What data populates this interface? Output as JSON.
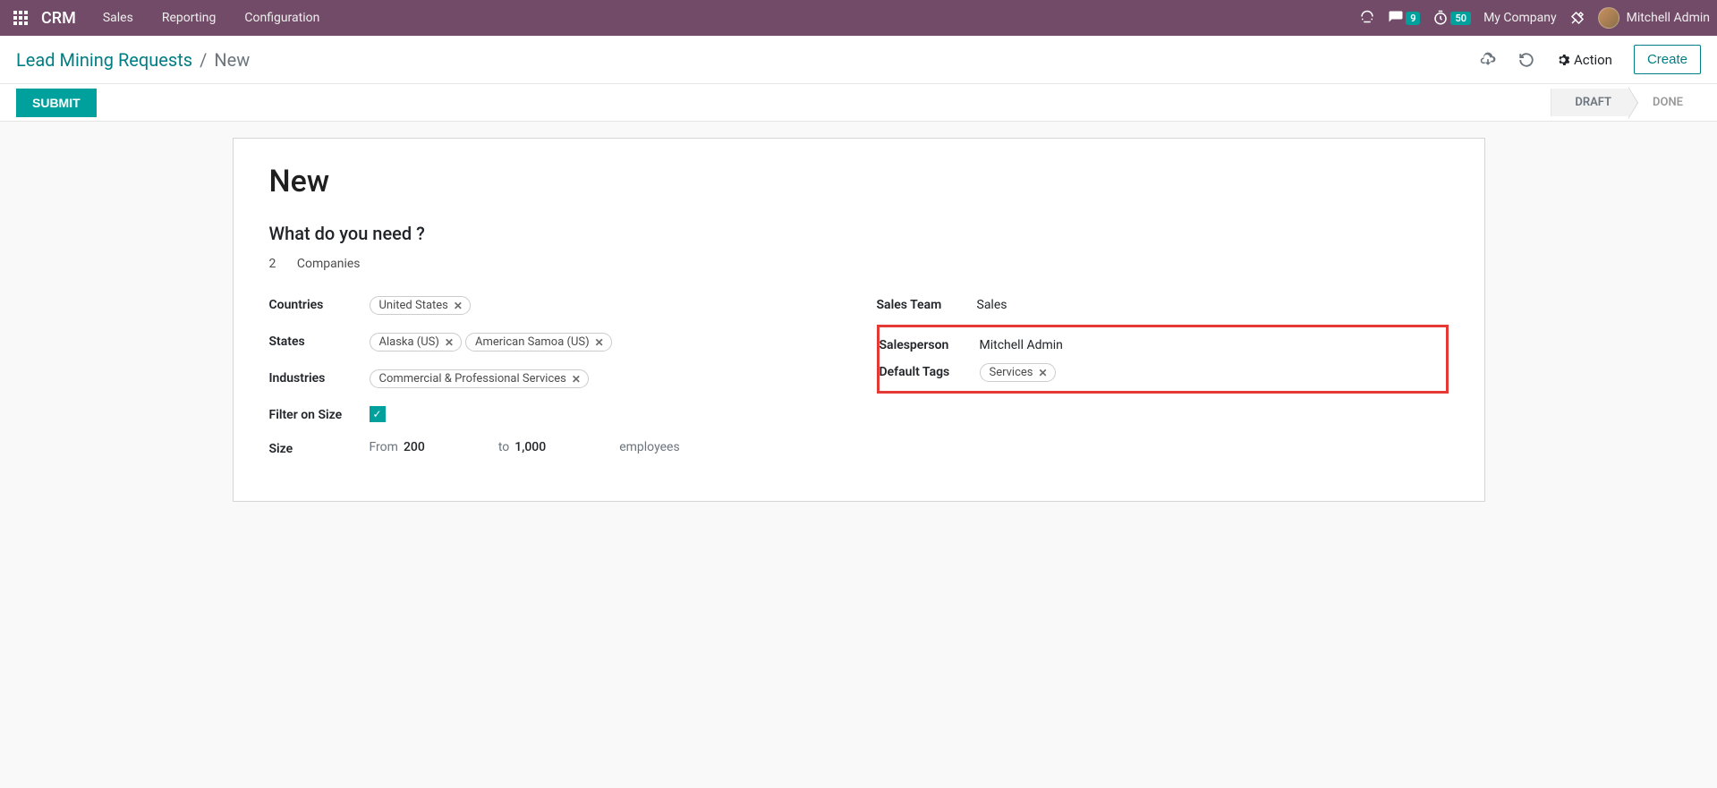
{
  "navbar": {
    "brand": "CRM",
    "menu": [
      "Sales",
      "Reporting",
      "Configuration"
    ],
    "discuss_badge": "9",
    "timer_badge": "50",
    "company": "My Company",
    "user": "Mitchell Admin"
  },
  "control": {
    "breadcrumb_link": "Lead Mining Requests",
    "breadcrumb_current": "New",
    "action_label": "Action",
    "create_label": "Create"
  },
  "status": {
    "submit_label": "SUBMIT",
    "steps": [
      "DRAFT",
      "DONE"
    ]
  },
  "form": {
    "title": "New",
    "section_title": "What do you need ?",
    "count_value": "2",
    "count_label": "Companies",
    "left": {
      "countries_label": "Countries",
      "countries_tags": [
        "United States"
      ],
      "states_label": "States",
      "states_tags": [
        "Alaska (US)",
        "American Samoa (US)"
      ],
      "industries_label": "Industries",
      "industries_tags": [
        "Commercial & Professional Services"
      ],
      "filter_size_label": "Filter on Size",
      "size_label": "Size",
      "size_from_pre": "From",
      "size_from_val": "200",
      "size_to_pre": "to",
      "size_to_val": "1,000",
      "size_unit": "employees"
    },
    "right": {
      "sales_team_label": "Sales Team",
      "sales_team_value": "Sales",
      "salesperson_label": "Salesperson",
      "salesperson_value": "Mitchell Admin",
      "default_tags_label": "Default Tags",
      "default_tags": [
        "Services"
      ]
    }
  }
}
